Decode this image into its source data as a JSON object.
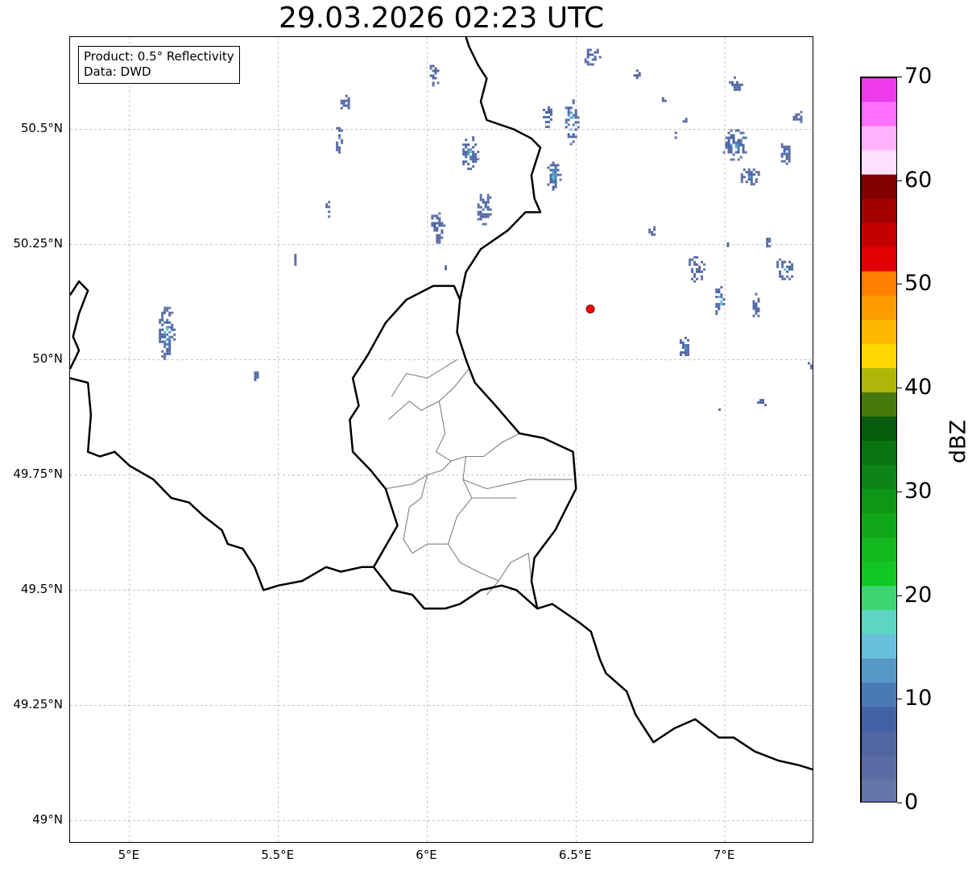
{
  "title": "29.03.2026 02:23 UTC",
  "info": {
    "product": "Product: 0.5° Reflectivity",
    "source": "Data: DWD"
  },
  "map": {
    "extent": {
      "lon_min": 4.8,
      "lon_max": 7.3,
      "lat_min": 48.95,
      "lat_max": 50.7
    },
    "lat_ticks": [
      {
        "value": 50.5,
        "label": "50.5°N"
      },
      {
        "value": 50.25,
        "label": "50.25°N"
      },
      {
        "value": 50.0,
        "label": "50°N"
      },
      {
        "value": 49.75,
        "label": "49.75°N"
      },
      {
        "value": 49.5,
        "label": "49.5°N"
      },
      {
        "value": 49.25,
        "label": "49.25°N"
      },
      {
        "value": 49.0,
        "label": "49°N"
      }
    ],
    "lon_ticks": [
      {
        "value": 5.0,
        "label": "5°E"
      },
      {
        "value": 5.5,
        "label": "5.5°E"
      },
      {
        "value": 6.0,
        "label": "6°E"
      },
      {
        "value": 6.5,
        "label": "6.5°E"
      },
      {
        "value": 7.0,
        "label": "7°E"
      }
    ],
    "radar_site": {
      "lon": 6.548,
      "lat": 50.11,
      "color": "#ff0000"
    },
    "border_color": "#000000",
    "district_color": "#808080",
    "borders": [
      [
        [
          4.8,
          50.14
        ],
        [
          4.83,
          50.17
        ],
        [
          4.86,
          50.15
        ],
        [
          4.83,
          50.1
        ],
        [
          4.81,
          50.05
        ],
        [
          4.83,
          50.02
        ],
        [
          4.8,
          49.98
        ]
      ],
      [
        [
          4.8,
          49.96
        ],
        [
          4.86,
          49.95
        ],
        [
          4.87,
          49.88
        ],
        [
          4.86,
          49.8
        ],
        [
          4.9,
          49.79
        ],
        [
          4.95,
          49.8
        ],
        [
          5.0,
          49.77
        ],
        [
          5.08,
          49.74
        ],
        [
          5.14,
          49.7
        ],
        [
          5.2,
          49.69
        ],
        [
          5.25,
          49.66
        ],
        [
          5.31,
          49.63
        ],
        [
          5.33,
          49.6
        ],
        [
          5.38,
          49.59
        ],
        [
          5.42,
          49.55
        ],
        [
          5.45,
          49.5
        ],
        [
          5.5,
          49.51
        ],
        [
          5.58,
          49.52
        ],
        [
          5.66,
          49.55
        ],
        [
          5.71,
          49.54
        ],
        [
          5.78,
          49.55
        ],
        [
          5.82,
          49.55
        ],
        [
          5.88,
          49.5
        ],
        [
          5.95,
          49.49
        ],
        [
          5.99,
          49.46
        ],
        [
          6.06,
          49.46
        ],
        [
          6.11,
          49.47
        ],
        [
          6.18,
          49.5
        ],
        [
          6.25,
          49.51
        ],
        [
          6.3,
          49.5
        ],
        [
          6.37,
          49.46
        ],
        [
          6.42,
          49.47
        ],
        [
          6.51,
          49.43
        ],
        [
          6.55,
          49.41
        ],
        [
          6.58,
          49.35
        ],
        [
          6.6,
          49.32
        ],
        [
          6.67,
          49.28
        ],
        [
          6.7,
          49.23
        ],
        [
          6.76,
          49.17
        ],
        [
          6.83,
          49.2
        ],
        [
          6.9,
          49.22
        ],
        [
          6.98,
          49.18
        ],
        [
          7.03,
          49.18
        ],
        [
          7.1,
          49.15
        ],
        [
          7.18,
          49.13
        ],
        [
          7.25,
          49.12
        ],
        [
          7.3,
          49.11
        ]
      ],
      [
        [
          5.82,
          49.55
        ],
        [
          5.9,
          49.64
        ],
        [
          5.86,
          49.72
        ],
        [
          5.81,
          49.76
        ],
        [
          5.75,
          49.8
        ],
        [
          5.74,
          49.87
        ],
        [
          5.77,
          49.9
        ],
        [
          5.75,
          49.96
        ],
        [
          5.8,
          50.01
        ],
        [
          5.86,
          50.08
        ],
        [
          5.93,
          50.13
        ],
        [
          6.02,
          50.16
        ],
        [
          6.09,
          50.16
        ],
        [
          6.11,
          50.13
        ]
      ],
      [
        [
          6.37,
          49.46
        ],
        [
          6.35,
          49.52
        ],
        [
          6.36,
          49.57
        ],
        [
          6.43,
          49.63
        ],
        [
          6.5,
          49.72
        ],
        [
          6.49,
          49.8
        ],
        [
          6.39,
          49.83
        ],
        [
          6.31,
          49.84
        ],
        [
          6.23,
          49.9
        ],
        [
          6.16,
          49.95
        ],
        [
          6.13,
          50.0
        ],
        [
          6.1,
          50.06
        ],
        [
          6.11,
          50.13
        ],
        [
          6.13,
          50.19
        ],
        [
          6.18,
          50.24
        ],
        [
          6.27,
          50.28
        ],
        [
          6.33,
          50.32
        ],
        [
          6.38,
          50.32
        ],
        [
          6.36,
          50.35
        ],
        [
          6.35,
          50.4
        ],
        [
          6.38,
          50.46
        ],
        [
          6.35,
          50.48
        ],
        [
          6.29,
          50.5
        ],
        [
          6.2,
          50.52
        ],
        [
          6.18,
          50.56
        ],
        [
          6.2,
          50.61
        ],
        [
          6.17,
          50.64
        ],
        [
          6.14,
          50.68
        ],
        [
          6.13,
          50.7
        ]
      ]
    ],
    "districts": [
      [
        [
          5.87,
          49.87
        ],
        [
          5.94,
          49.91
        ],
        [
          5.98,
          49.89
        ],
        [
          6.04,
          49.91
        ],
        [
          6.09,
          49.94
        ],
        [
          6.14,
          49.98
        ],
        [
          6.13,
          50.0
        ]
      ],
      [
        [
          6.04,
          49.91
        ],
        [
          6.06,
          49.84
        ],
        [
          6.03,
          49.8
        ],
        [
          6.08,
          49.78
        ],
        [
          6.13,
          49.79
        ],
        [
          6.19,
          49.79
        ],
        [
          6.25,
          49.82
        ],
        [
          6.31,
          49.84
        ]
      ],
      [
        [
          6.13,
          49.79
        ],
        [
          6.12,
          49.74
        ],
        [
          6.15,
          49.7
        ],
        [
          6.1,
          49.66
        ],
        [
          6.07,
          49.6
        ],
        [
          6.11,
          49.56
        ],
        [
          6.17,
          49.54
        ],
        [
          6.24,
          49.52
        ],
        [
          6.28,
          49.56
        ],
        [
          6.34,
          49.58
        ],
        [
          6.35,
          49.52
        ]
      ],
      [
        [
          5.86,
          49.72
        ],
        [
          5.95,
          49.73
        ],
        [
          6.0,
          49.75
        ],
        [
          6.05,
          49.76
        ],
        [
          6.08,
          49.78
        ]
      ],
      [
        [
          6.12,
          49.74
        ],
        [
          6.2,
          49.72
        ],
        [
          6.27,
          49.73
        ],
        [
          6.34,
          49.74
        ],
        [
          6.42,
          49.74
        ],
        [
          6.49,
          49.74
        ]
      ],
      [
        [
          6.15,
          49.7
        ],
        [
          6.22,
          49.7
        ],
        [
          6.3,
          49.7
        ]
      ],
      [
        [
          6.0,
          49.75
        ],
        [
          5.98,
          49.7
        ],
        [
          5.94,
          49.68
        ],
        [
          5.92,
          49.61
        ],
        [
          5.95,
          49.58
        ]
      ],
      [
        [
          5.95,
          49.58
        ],
        [
          6.0,
          49.6
        ],
        [
          6.07,
          49.6
        ]
      ],
      [
        [
          6.24,
          49.52
        ],
        [
          6.2,
          49.49
        ]
      ],
      [
        [
          5.88,
          49.92
        ],
        [
          5.93,
          49.97
        ],
        [
          6.0,
          49.96
        ],
        [
          6.05,
          49.98
        ],
        [
          6.1,
          50.0
        ]
      ]
    ],
    "radar_cells": [
      {
        "lon": 5.12,
        "lat": 50.06,
        "w": 0.06,
        "h": 0.12,
        "peak": 20
      },
      {
        "lon": 5.42,
        "lat": 49.97,
        "w": 0.02,
        "h": 0.03,
        "peak": 6
      },
      {
        "lon": 5.72,
        "lat": 50.56,
        "w": 0.04,
        "h": 0.04,
        "peak": 8
      },
      {
        "lon": 5.7,
        "lat": 50.48,
        "w": 0.03,
        "h": 0.06,
        "peak": 14
      },
      {
        "lon": 5.66,
        "lat": 50.33,
        "w": 0.02,
        "h": 0.05,
        "peak": 6
      },
      {
        "lon": 5.55,
        "lat": 50.22,
        "w": 0.01,
        "h": 0.03,
        "peak": 5
      },
      {
        "lon": 6.02,
        "lat": 50.62,
        "w": 0.04,
        "h": 0.05,
        "peak": 8
      },
      {
        "lon": 6.14,
        "lat": 50.45,
        "w": 0.06,
        "h": 0.08,
        "peak": 18
      },
      {
        "lon": 6.03,
        "lat": 50.29,
        "w": 0.05,
        "h": 0.07,
        "peak": 9
      },
      {
        "lon": 6.19,
        "lat": 50.33,
        "w": 0.06,
        "h": 0.07,
        "peak": 12
      },
      {
        "lon": 6.06,
        "lat": 50.2,
        "w": 0.02,
        "h": 0.02,
        "peak": 6
      },
      {
        "lon": 6.48,
        "lat": 50.52,
        "w": 0.05,
        "h": 0.1,
        "peak": 24
      },
      {
        "lon": 6.4,
        "lat": 50.53,
        "w": 0.04,
        "h": 0.05,
        "peak": 16
      },
      {
        "lon": 6.42,
        "lat": 50.4,
        "w": 0.05,
        "h": 0.07,
        "peak": 20
      },
      {
        "lon": 6.55,
        "lat": 50.66,
        "w": 0.06,
        "h": 0.04,
        "peak": 14
      },
      {
        "lon": 6.7,
        "lat": 50.62,
        "w": 0.03,
        "h": 0.03,
        "peak": 12
      },
      {
        "lon": 6.79,
        "lat": 50.57,
        "w": 0.02,
        "h": 0.02,
        "peak": 8
      },
      {
        "lon": 6.86,
        "lat": 50.52,
        "w": 0.02,
        "h": 0.02,
        "peak": 8
      },
      {
        "lon": 6.75,
        "lat": 50.28,
        "w": 0.03,
        "h": 0.03,
        "peak": 6
      },
      {
        "lon": 6.83,
        "lat": 50.49,
        "w": 0.03,
        "h": 0.02,
        "peak": 7
      },
      {
        "lon": 7.03,
        "lat": 50.47,
        "w": 0.09,
        "h": 0.07,
        "peak": 18
      },
      {
        "lon": 7.08,
        "lat": 50.4,
        "w": 0.07,
        "h": 0.04,
        "peak": 16
      },
      {
        "lon": 7.2,
        "lat": 50.45,
        "w": 0.04,
        "h": 0.05,
        "peak": 14
      },
      {
        "lon": 7.03,
        "lat": 50.6,
        "w": 0.05,
        "h": 0.04,
        "peak": 9
      },
      {
        "lon": 7.24,
        "lat": 50.53,
        "w": 0.04,
        "h": 0.03,
        "peak": 8
      },
      {
        "lon": 6.9,
        "lat": 50.2,
        "w": 0.06,
        "h": 0.06,
        "peak": 10
      },
      {
        "lon": 7.0,
        "lat": 50.25,
        "w": 0.02,
        "h": 0.02,
        "peak": 14
      },
      {
        "lon": 6.98,
        "lat": 50.13,
        "w": 0.04,
        "h": 0.07,
        "peak": 20
      },
      {
        "lon": 7.1,
        "lat": 50.12,
        "w": 0.03,
        "h": 0.06,
        "peak": 10
      },
      {
        "lon": 7.2,
        "lat": 50.2,
        "w": 0.07,
        "h": 0.05,
        "peak": 16
      },
      {
        "lon": 7.14,
        "lat": 50.26,
        "w": 0.02,
        "h": 0.03,
        "peak": 7
      },
      {
        "lon": 6.86,
        "lat": 50.03,
        "w": 0.04,
        "h": 0.05,
        "peak": 16
      },
      {
        "lon": 7.12,
        "lat": 49.91,
        "w": 0.04,
        "h": 0.02,
        "peak": 12
      },
      {
        "lon": 7.28,
        "lat": 49.99,
        "w": 0.02,
        "h": 0.02,
        "peak": 6
      },
      {
        "lon": 6.98,
        "lat": 49.9,
        "w": 0.02,
        "h": 0.02,
        "peak": 5
      }
    ]
  },
  "colorbar": {
    "label": "dBZ",
    "min": 0,
    "max": 70,
    "ticks": [
      {
        "value": 0,
        "label": "0"
      },
      {
        "value": 10,
        "label": "10"
      },
      {
        "value": 20,
        "label": "20"
      },
      {
        "value": 30,
        "label": "30"
      },
      {
        "value": 40,
        "label": "40"
      },
      {
        "value": 50,
        "label": "50"
      },
      {
        "value": 60,
        "label": "60"
      },
      {
        "value": 70,
        "label": "70"
      }
    ],
    "colors": [
      "#6577a8",
      "#5a6ca3",
      "#4f66a3",
      "#4460a5",
      "#4a7ab4",
      "#5698c6",
      "#66c0de",
      "#5cd5c3",
      "#3dd572",
      "#11c723",
      "#13b81e",
      "#10a71a",
      "#0e9617",
      "#0c8516",
      "#0a7412",
      "#085c0d",
      "#467a0c",
      "#b0b50a",
      "#ffd600",
      "#ffb800",
      "#ff9d00",
      "#ff7f00",
      "#e30000",
      "#c40000",
      "#a50000",
      "#820000",
      "#ffe0ff",
      "#ffb3ff",
      "#ff70ff",
      "#ed3aed"
    ]
  }
}
